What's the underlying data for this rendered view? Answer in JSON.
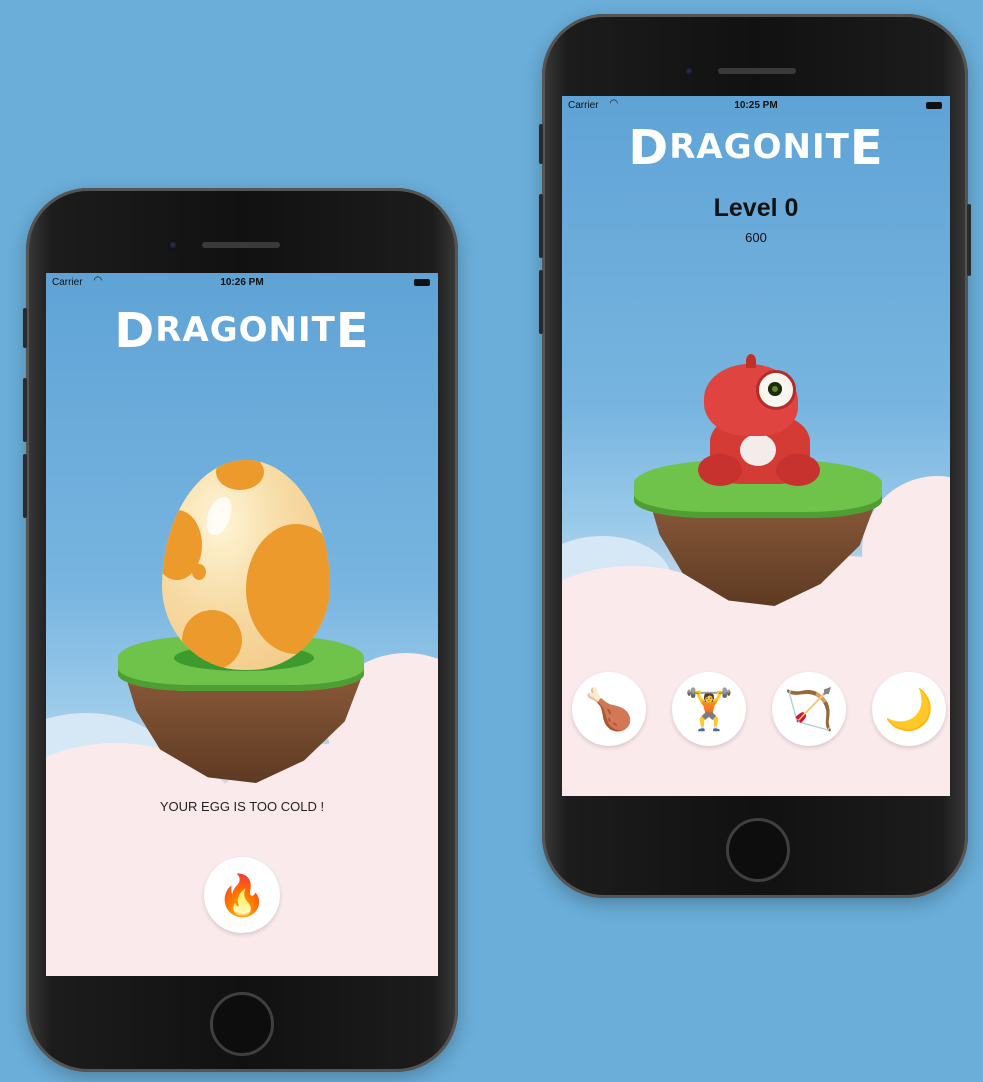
{
  "left_phone": {
    "status": {
      "carrier": "Carrier",
      "time": "10:26 PM"
    },
    "logo": {
      "first": "D",
      "middle": "RAGONIT",
      "last": "E"
    },
    "message": "YOUR EGG IS TOO COLD !",
    "actions": [
      {
        "icon": "fire-icon",
        "glyph": "🔥"
      }
    ]
  },
  "right_phone": {
    "status": {
      "carrier": "Carrier",
      "time": "10:25 PM"
    },
    "logo": {
      "first": "D",
      "middle": "RAGONIT",
      "last": "E"
    },
    "level_label": "Level 0",
    "score": "600",
    "actions": [
      {
        "icon": "meat-icon",
        "glyph": "🍗"
      },
      {
        "icon": "dumbbell-icon",
        "glyph": "🏋"
      },
      {
        "icon": "bow-arrow-icon",
        "glyph": "🏹"
      },
      {
        "icon": "sleep-moon-icon",
        "glyph": "🌙"
      }
    ]
  },
  "colors": {
    "background": "#6aaed9",
    "grass": "#6fc24a",
    "dragon": "#d93a36",
    "egg": "#f0a43a"
  }
}
